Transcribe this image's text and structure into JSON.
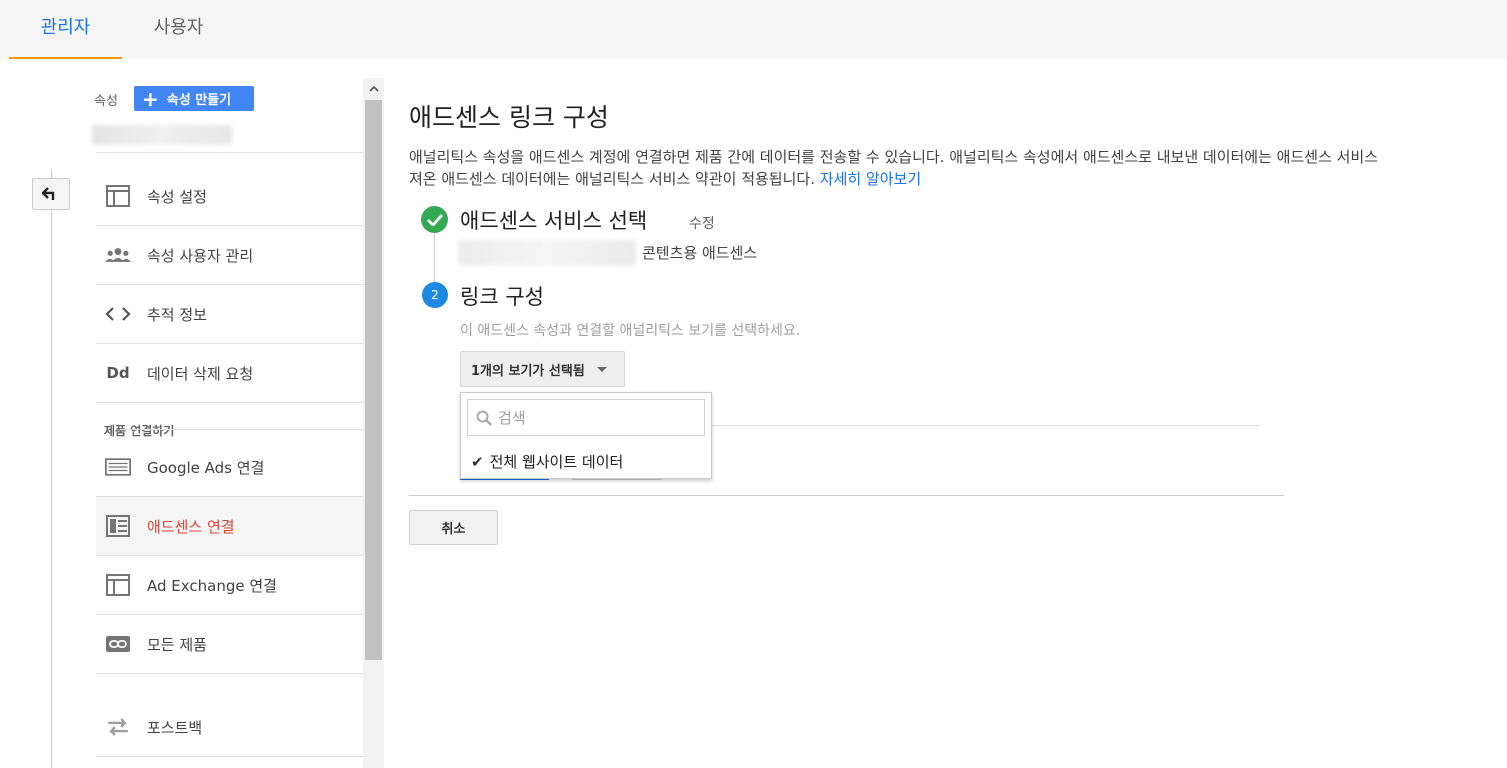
{
  "tabs": [
    {
      "label": "관리자",
      "active": true
    },
    {
      "label": "사용자",
      "active": false
    }
  ],
  "sidebar": {
    "property_label": "속성",
    "create_button": "속성 만들기",
    "items": [
      {
        "label": "속성 설정",
        "icon": "layout-icon"
      },
      {
        "label": "속성 사용자 관리",
        "icon": "users-icon"
      },
      {
        "label": "추적 정보",
        "icon": "code-icon"
      },
      {
        "label": "데이터 삭제 요청",
        "icon": "dd-icon"
      }
    ],
    "section_heading": "제품 연결하기",
    "product_items": [
      {
        "label": "Google Ads 연결",
        "icon": "ads-icon"
      },
      {
        "label": "애드센스 연결",
        "icon": "adsense-icon",
        "active": true
      },
      {
        "label": "Ad Exchange 연결",
        "icon": "layout-icon"
      },
      {
        "label": "모든 제품",
        "icon": "link-icon"
      },
      {
        "label": "포스트백",
        "icon": "postback-icon"
      }
    ]
  },
  "main": {
    "title": "애드센스 링크 구성",
    "description_line1": "애널리틱스 속성을 애드센스 계정에 연결하면 제품 간에 데이터를 전송할 수 있습니다. 애널리틱스 속성에서 애드센스로 내보낸 데이터에는 애드센스 서비스",
    "description_line2": "져온 애드센스 데이터에는 애널리틱스 서비스 약관이 적용됩니다.",
    "learn_more": "자세히 알아보기",
    "step1": {
      "title": "애드센스 서비스 선택",
      "edit": "수정",
      "subtitle": "콘텐츠용 애드센스"
    },
    "step2": {
      "number": "2",
      "title": "링크 구성",
      "description": "이 애드센스 속성과 연결할 애널리틱스 보기를 선택하세요.",
      "dropdown_label": "1개의 보기가 선택됨",
      "search_placeholder": "검색",
      "option_label": "전체 웹사이트 데이터"
    },
    "cancel": "취소"
  },
  "colors": {
    "accent_blue": "#1a73e8",
    "tab_underline": "#f29900",
    "active_red": "#db4437",
    "success_green": "#34a853",
    "step_blue": "#1e88e5"
  }
}
